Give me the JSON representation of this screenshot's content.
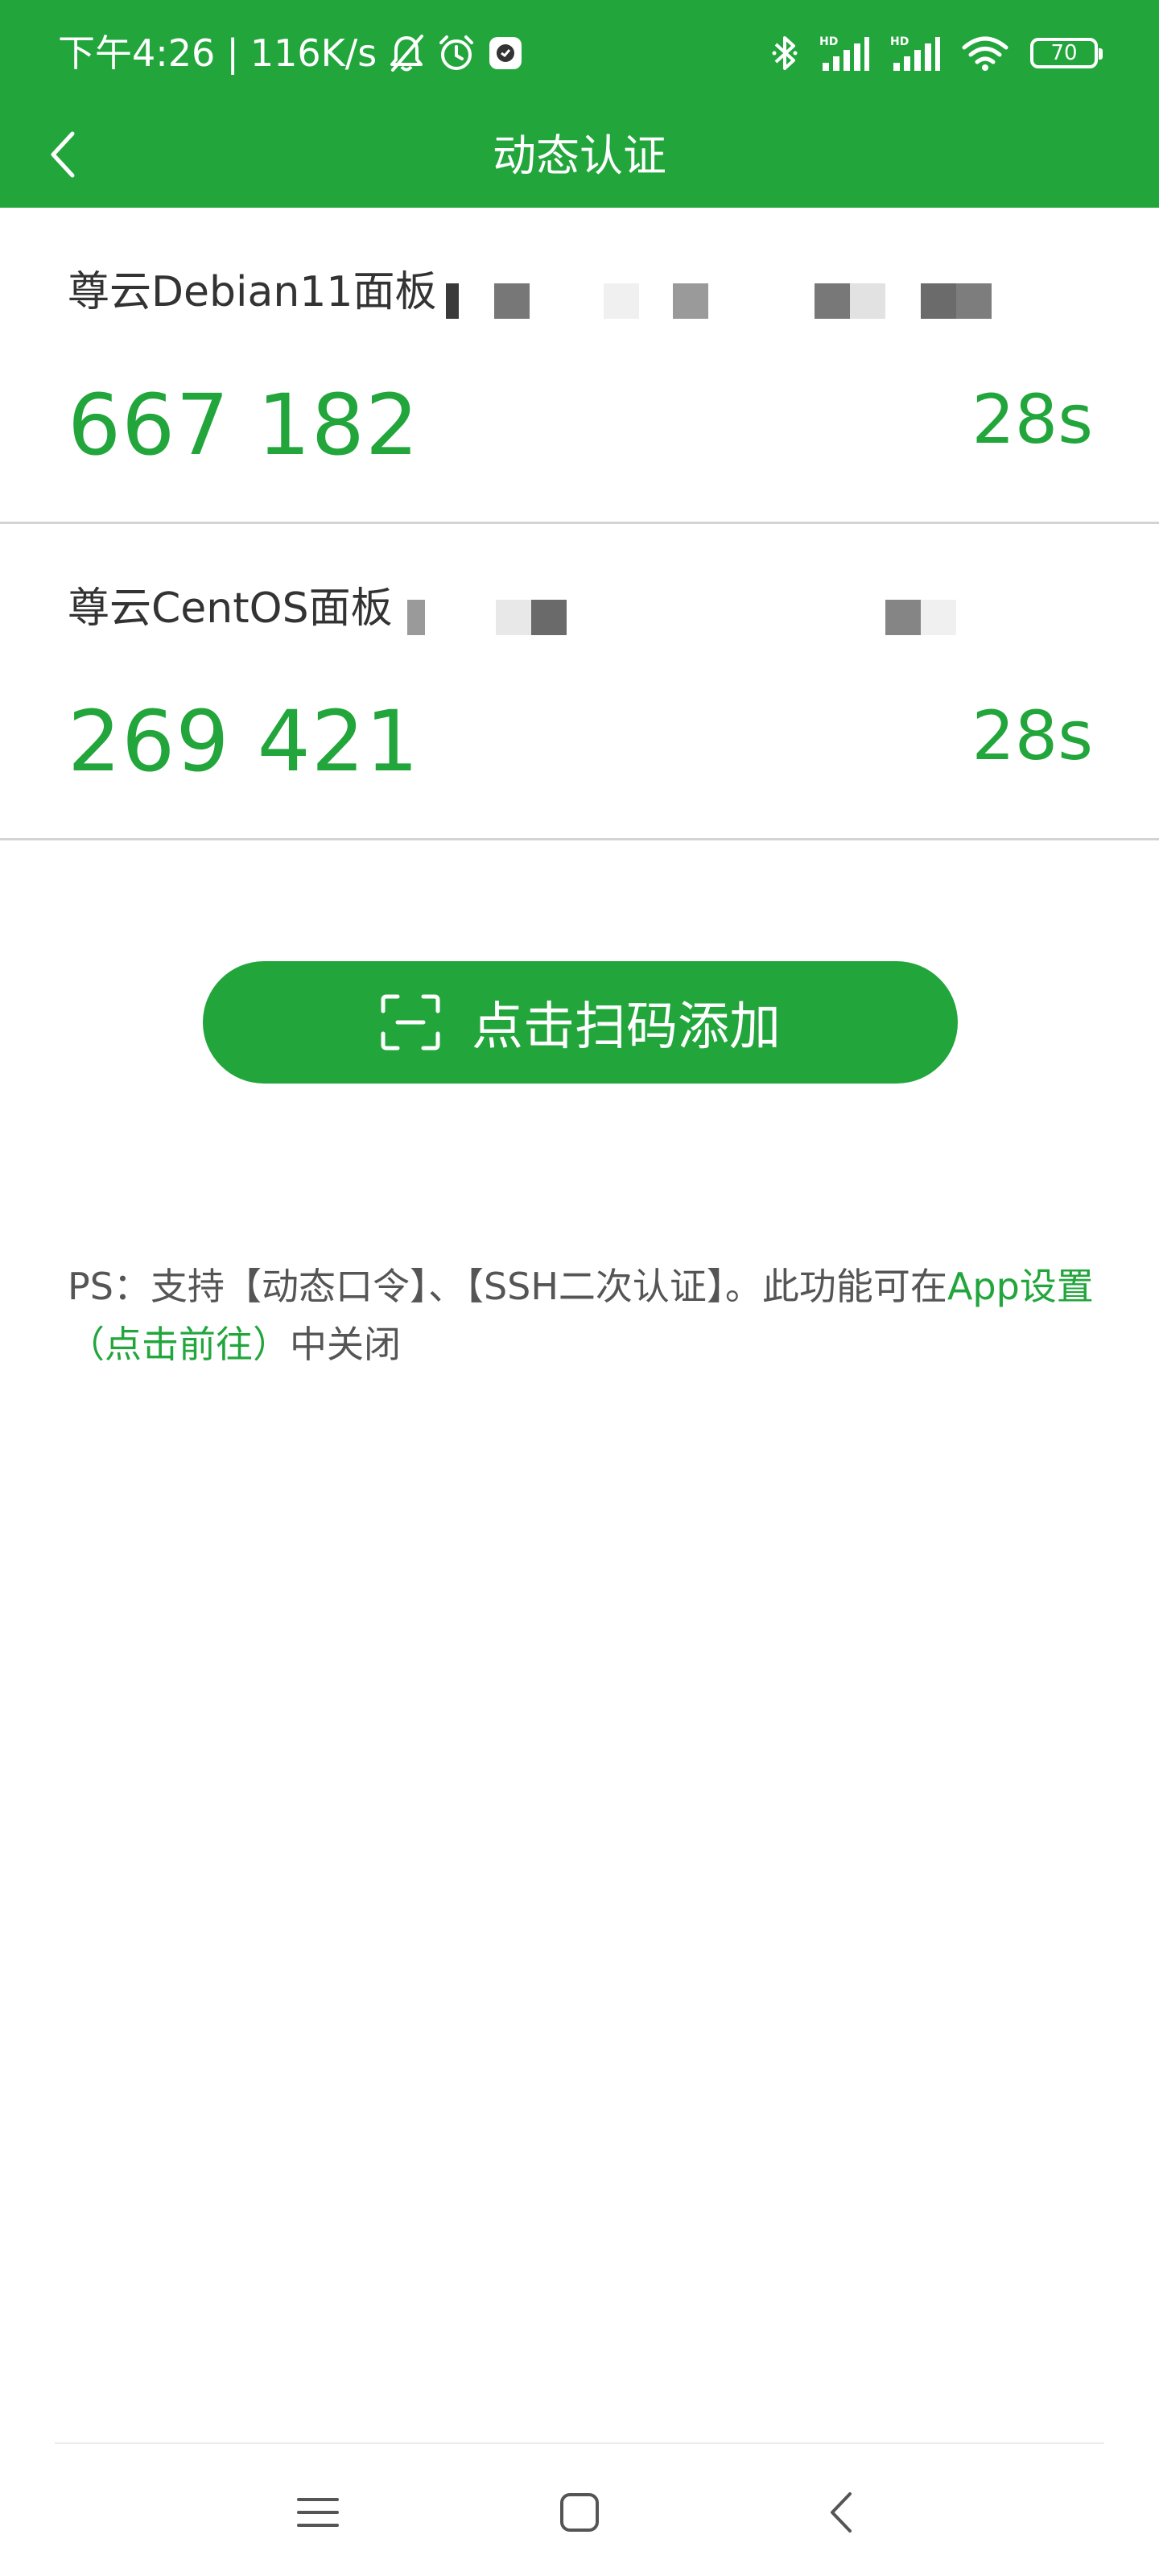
{
  "status_bar": {
    "time": "下午4:26",
    "separator": "|",
    "network_speed": "116K/s",
    "battery_level": "70",
    "icons": [
      "bell-off-icon",
      "alarm-icon",
      "app-notification-icon",
      "bluetooth-icon",
      "signal-hd-icon",
      "signal-hd-icon",
      "wifi-icon",
      "battery-icon"
    ]
  },
  "app_bar": {
    "title": "动态认证",
    "back_icon": "chevron-left-icon"
  },
  "accounts": [
    {
      "name": "尊云Debian11面板",
      "code": "667 182",
      "remaining": "28s"
    },
    {
      "name": "尊云CentOS面板",
      "code": "269 421",
      "remaining": "28s"
    }
  ],
  "scan_button": {
    "label": "点击扫码添加",
    "icon": "scan-icon"
  },
  "note": {
    "prefix": "PS：支持【动态口令】、【SSH二次认证】。此功能可在",
    "link": "App设置（点击前往）",
    "suffix": "中关闭"
  },
  "nav_bar": {
    "icons": [
      "menu-icon",
      "home-square-icon",
      "back-triangle-icon"
    ]
  },
  "colors": {
    "brand_green": "#22a63c",
    "divider": "#d3d3d3",
    "text": "#333333"
  }
}
